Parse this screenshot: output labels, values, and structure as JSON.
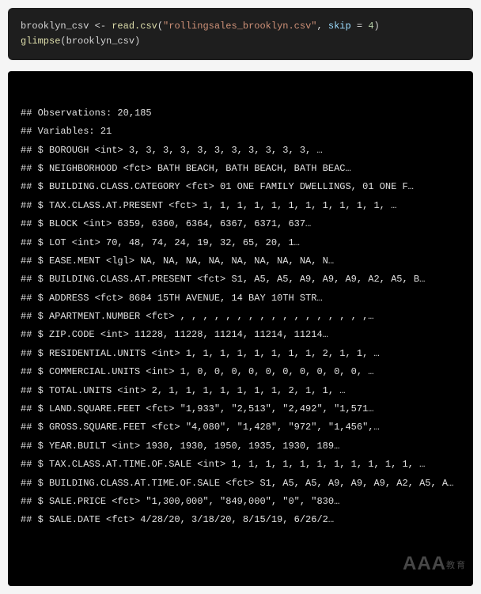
{
  "code": {
    "line1_var": "brooklyn_csv",
    "line1_assign": " <- ",
    "line1_fn": "read.csv",
    "line1_open": "(",
    "line1_str": "\"rollingsales_brooklyn.csv\"",
    "line1_sep": ", ",
    "line1_arg": "skip",
    "line1_eq": " = ",
    "line1_num": "4",
    "line1_close": ")",
    "line2_fn": "glimpse",
    "line2_open": "(",
    "line2_arg": "brooklyn_csv",
    "line2_close": ")"
  },
  "output": {
    "obs": "## Observations: 20,185",
    "vars": "## Variables: 21",
    "lines": [
      "## $ BOROUGH <int> 3, 3, 3, 3, 3, 3, 3, 3, 3, 3, 3, …",
      "## $ NEIGHBORHOOD <fct> BATH BEACH, BATH BEACH, BATH BEAC…",
      "## $ BUILDING.CLASS.CATEGORY <fct> 01 ONE FAMILY DWELLINGS, 01 ONE F…",
      "## $ TAX.CLASS.AT.PRESENT <fct> 1, 1, 1, 1, 1, 1, 1, 1, 1, 1, 1, …",
      "## $ BLOCK <int> 6359, 6360, 6364, 6367, 6371, 637…",
      "## $ LOT <int> 70, 48, 74, 24, 19, 32, 65, 20, 1…",
      "## $ EASE.MENT <lgl> NA, NA, NA, NA, NA, NA, NA, NA, N…",
      "## $ BUILDING.CLASS.AT.PRESENT <fct> S1, A5, A5, A9, A9, A9, A2, A5, B…",
      "## $ ADDRESS <fct> 8684 15TH AVENUE, 14 BAY 10TH STR…",
      "## $ APARTMENT.NUMBER <fct> , , , , , , , , , , , , , , , , ,…",
      "## $ ZIP.CODE <int> 11228, 11228, 11214, 11214, 11214…",
      "## $ RESIDENTIAL.UNITS <int> 1, 1, 1, 1, 1, 1, 1, 1, 2, 1, 1, …",
      "## $ COMMERCIAL.UNITS <int> 1, 0, 0, 0, 0, 0, 0, 0, 0, 0, 0, …",
      "## $ TOTAL.UNITS <int> 2, 1, 1, 1, 1, 1, 1, 1, 2, 1, 1, …",
      "## $ LAND.SQUARE.FEET <fct> \"1,933\", \"2,513\", \"2,492\", \"1,571…",
      "## $ GROSS.SQUARE.FEET <fct> \"4,080\", \"1,428\", \"972\", \"1,456\",…",
      "## $ YEAR.BUILT <int> 1930, 1930, 1950, 1935, 1930, 189…",
      "## $ TAX.CLASS.AT.TIME.OF.SALE <int> 1, 1, 1, 1, 1, 1, 1, 1, 1, 1, 1, …",
      "## $ BUILDING.CLASS.AT.TIME.OF.SALE <fct> S1, A5, A5, A9, A9, A9, A2, A5, A…",
      "## $ SALE.PRICE <fct> \"1,300,000\", \"849,000\", \"0\", \"830…",
      "## $ SALE.DATE <fct> 4/28/20, 3/18/20, 8/15/19, 6/26/2…"
    ]
  },
  "watermark": {
    "main": "AAA",
    "sub": "教育"
  }
}
